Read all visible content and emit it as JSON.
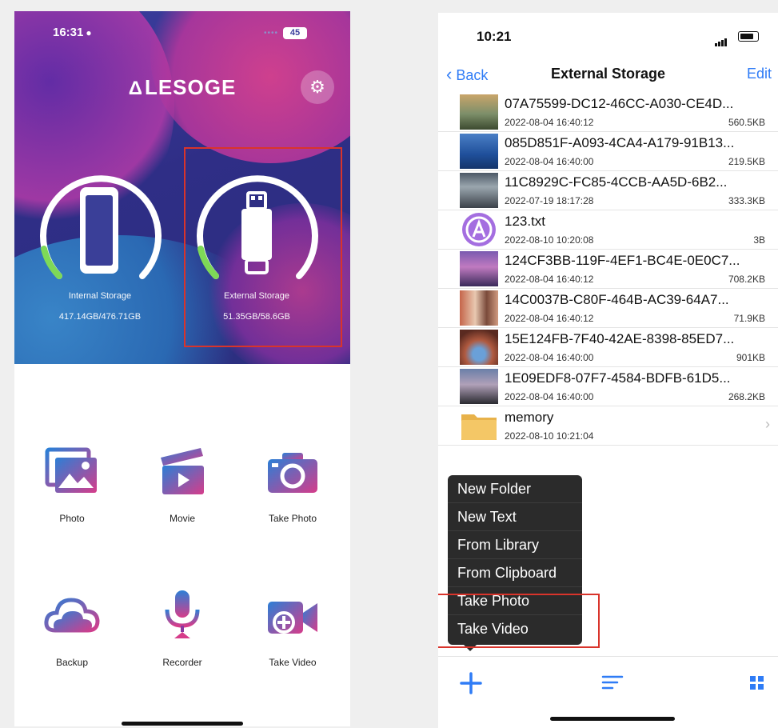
{
  "left": {
    "status": {
      "time": "16:31",
      "battery": "45"
    },
    "brand": "LESOGE",
    "storage": [
      {
        "name": "Internal Storage",
        "usage": "417.14GB/476.71GB"
      },
      {
        "name": "External Storage",
        "usage": "51.35GB/58.6GB"
      }
    ],
    "apps": [
      {
        "label": "Photo"
      },
      {
        "label": "Movie"
      },
      {
        "label": "Take Photo"
      },
      {
        "label": "Backup"
      },
      {
        "label": "Recorder"
      },
      {
        "label": "Take Video"
      }
    ]
  },
  "right": {
    "status": {
      "time": "10:21"
    },
    "nav": {
      "back": "Back",
      "title": "External Storage",
      "edit": "Edit"
    },
    "files": [
      {
        "name": "07A75599-DC12-46CC-A030-CE4D...",
        "date": "2022-08-04 16:40:12",
        "size": "560.5KB"
      },
      {
        "name": "085D851F-A093-4CA4-A179-91B13...",
        "date": "2022-08-04 16:40:00",
        "size": "219.5KB"
      },
      {
        "name": "11C8929C-FC85-4CCB-AA5D-6B2...",
        "date": "2022-07-19 18:17:28",
        "size": "333.3KB"
      },
      {
        "name": "123.txt",
        "date": "2022-08-10 10:20:08",
        "size": "3B"
      },
      {
        "name": "124CF3BB-119F-4EF1-BC4E-0E0C7...",
        "date": "2022-08-04 16:40:12",
        "size": "708.2KB"
      },
      {
        "name": "14C0037B-C80F-464B-AC39-64A7...",
        "date": "2022-08-04 16:40:12",
        "size": "71.9KB"
      },
      {
        "name": "15E124FB-7F40-42AE-8398-85ED7...",
        "date": "2022-08-04 16:40:00",
        "size": "901KB"
      },
      {
        "name": "1E09EDF8-07F7-4584-BDFB-61D5...",
        "date": "2022-08-04 16:40:00",
        "size": "268.2KB"
      },
      {
        "name": "memory",
        "date": "2022-08-10 10:21:04",
        "size": ""
      }
    ],
    "menu": [
      "New Folder",
      "New Text",
      "From Library",
      "From Clipboard",
      "Take Photo",
      "Take Video"
    ]
  },
  "colors": {
    "accent": "#2f7cf6",
    "highlight": "#d9342b",
    "progress": "#7ed957"
  },
  "icons": {
    "settings": "gear-icon",
    "add": "plus-icon",
    "sort": "sort-icon",
    "grid": "grid-icon"
  }
}
